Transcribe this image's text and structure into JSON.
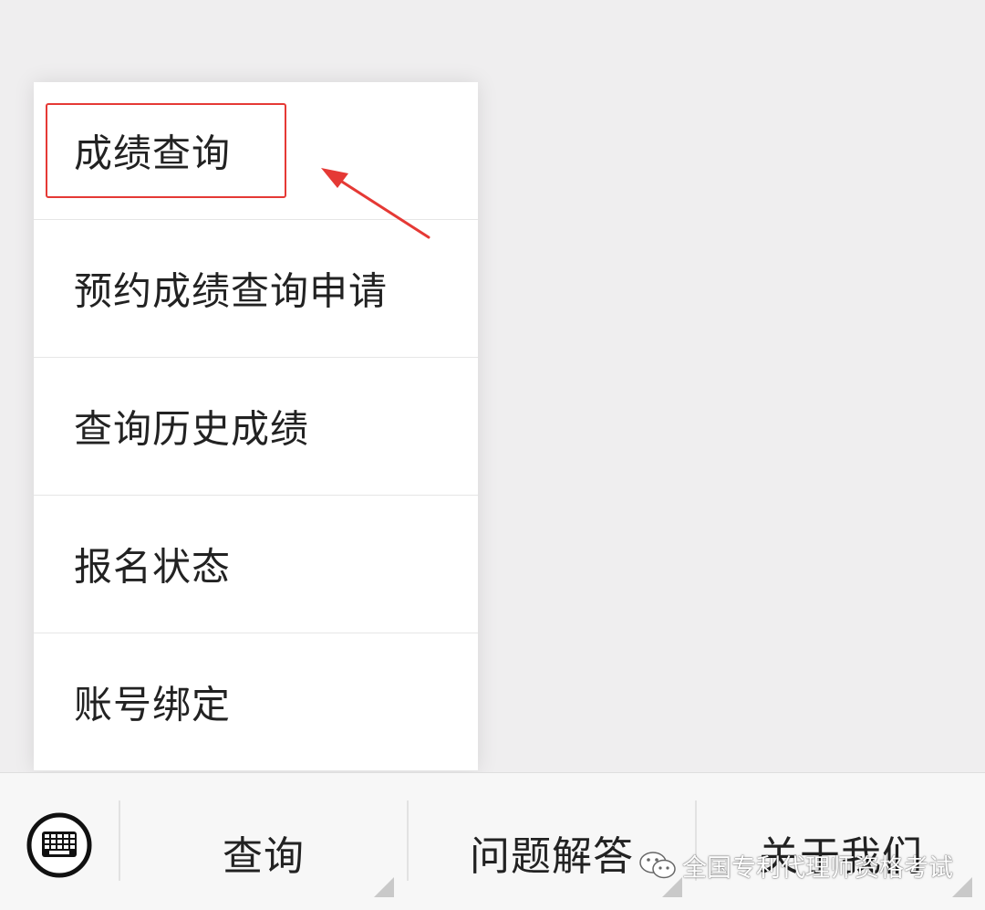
{
  "menu": {
    "items": [
      {
        "label": "成绩查询"
      },
      {
        "label": "预约成绩查询申请"
      },
      {
        "label": "查询历史成绩"
      },
      {
        "label": "报名状态"
      },
      {
        "label": "账号绑定"
      }
    ],
    "highlight_color": "#e53935"
  },
  "bottom_bar": {
    "keyboard_icon": "keyboard-icon",
    "tabs": [
      {
        "label": "查询"
      },
      {
        "label": "问题解答"
      },
      {
        "label": "关于我们"
      }
    ]
  },
  "watermark": {
    "icon": "wechat-icon",
    "text": "全国专利代理师资格考试"
  }
}
